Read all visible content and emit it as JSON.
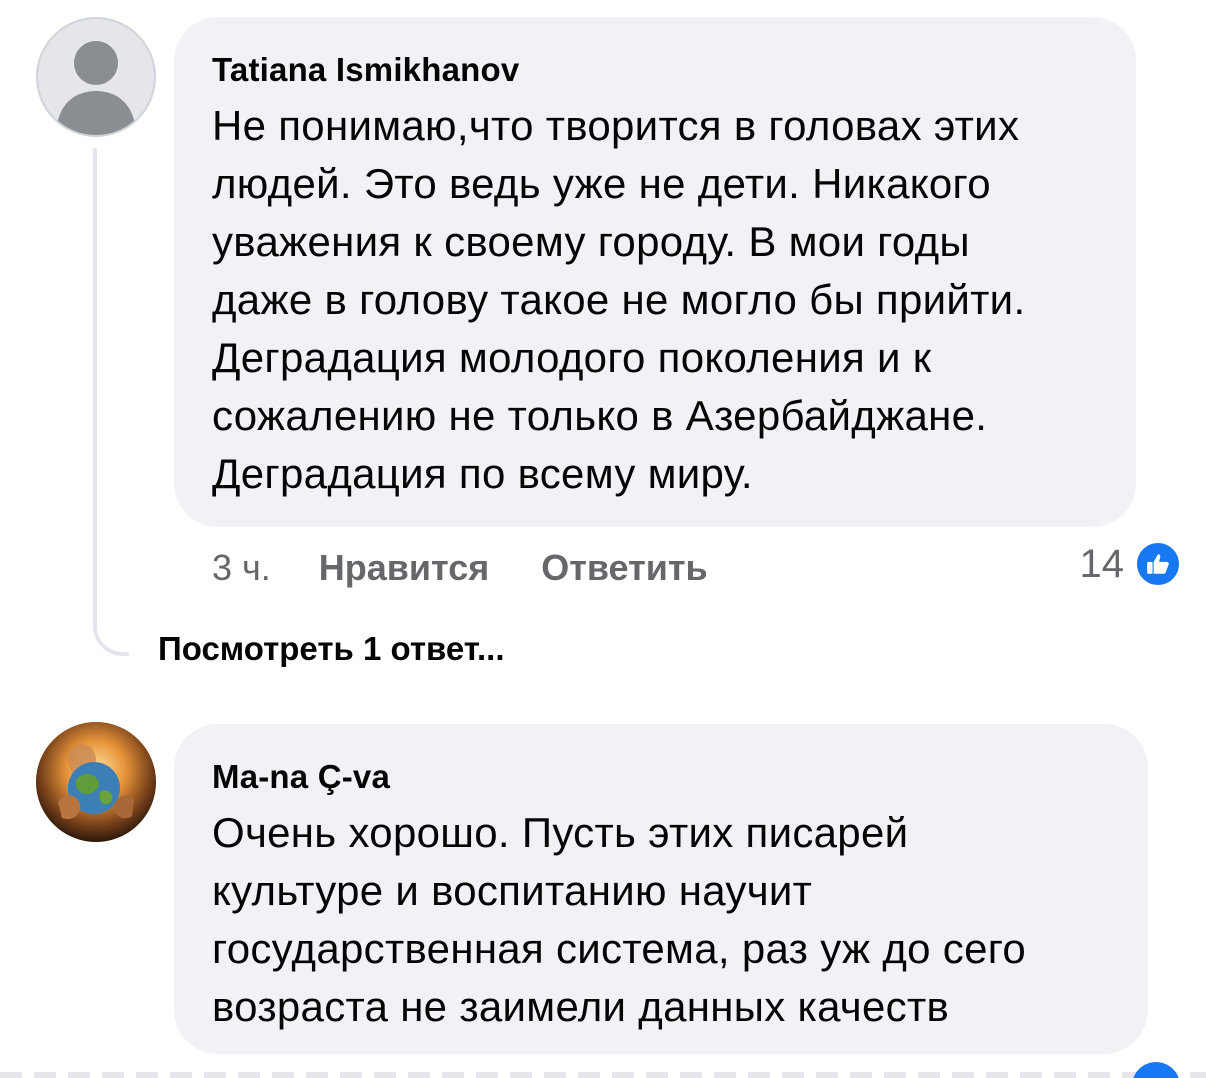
{
  "comments": [
    {
      "author": "Tatiana Ismikhanov",
      "text": "Не понимаю,что творится в головах этих\nлюдей. Это ведь уже не дети. Никакого\nуважения к своему городу. В мои годы\nдаже в голову такое не могло бы прийти.\nДеградация молодого поколения и к\nсожалению не только в Азербайджане.\nДеградация по всему миру.",
      "time": "3 ч.",
      "like_label": "Нравится",
      "reply_label": "Ответить",
      "reaction_count": "14",
      "avatar": "default-user-avatar",
      "view_replies": "Посмотреть 1 ответ..."
    },
    {
      "author": "Ma-na Ç-va",
      "text": "Очень хорошо. Пусть этих писарей\nкультуре и  воспитанию научит\nгосударственная система, раз уж до сего\nвозраста не заимели данных качеств",
      "avatar": "photo-avatar-earth-in-hands"
    }
  ],
  "colors": {
    "bubble": "#f0f2f5",
    "text": "#050505",
    "muted": "#65676b",
    "like_blue": "#1877f2"
  },
  "icons": {
    "reaction": "like-thumbs-up-icon"
  }
}
